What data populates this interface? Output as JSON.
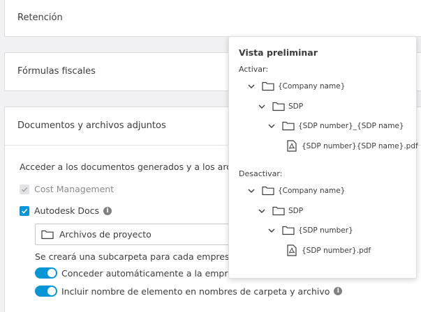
{
  "sections": {
    "retencion": "Retención",
    "formulas": "Fórmulas fiscales",
    "documentos": "Documentos y archivos adjuntos"
  },
  "documentos": {
    "access_text": "Acceder a los documentos generados y a los archivos",
    "cost_management": "Cost Management",
    "autodesk_docs": "Autodesk Docs",
    "folder_value": "Archivos de proyecto",
    "subfolder_text": "Se creará una subcarpeta para cada empresa",
    "toggle_auto": "Conceder automáticamente a la empresa",
    "toggle_include": "Incluir nombre de elemento en nombres de carpeta y archivo"
  },
  "preview": {
    "title": "Vista preliminar",
    "activate_label": "Activar:",
    "activate_tree": [
      "{Company name}",
      "SDP",
      "{SDP number}_{SDP name}",
      "{SDP number}{SDP name}.pdf"
    ],
    "deactivate_label": "Desactivar:",
    "deactivate_tree": [
      "{Company name}",
      "SDP",
      "{SDP number}",
      "{SDP number}.pdf"
    ]
  },
  "colors": {
    "accent": "#0696d7",
    "icon": "#3c3c3c"
  }
}
